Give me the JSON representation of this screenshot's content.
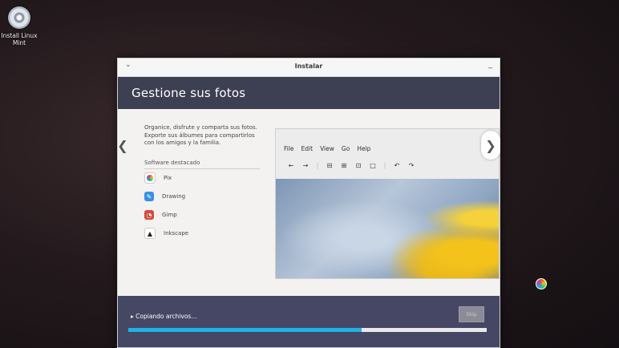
{
  "desktop": {
    "icon_label": "Install Linux Mint"
  },
  "window": {
    "title": "Instalar"
  },
  "slide": {
    "heading": "Gestione sus fotos",
    "description_lines": [
      "Organice, disfrute y comparta sus fotos.",
      "Exporte sus álbumes para compartirlos",
      "con los amigos y la familia."
    ],
    "featured_title": "Software destacado",
    "software": [
      "Pix",
      "Drawing",
      "Gimp",
      "Inkscape"
    ],
    "preview_menu": [
      "File",
      "Edit",
      "View",
      "Go",
      "Help"
    ],
    "preview_tools": [
      "←",
      "→",
      "⊟",
      "⊞",
      "⊡",
      "□",
      "↶",
      "↷"
    ]
  },
  "progress": {
    "status": "Copiando archivos...",
    "skip_label": "Skip",
    "fraction": 0.65
  },
  "colors": {
    "header": "#3d3f52",
    "footer": "#454764",
    "progress": "#1fb2e5"
  }
}
